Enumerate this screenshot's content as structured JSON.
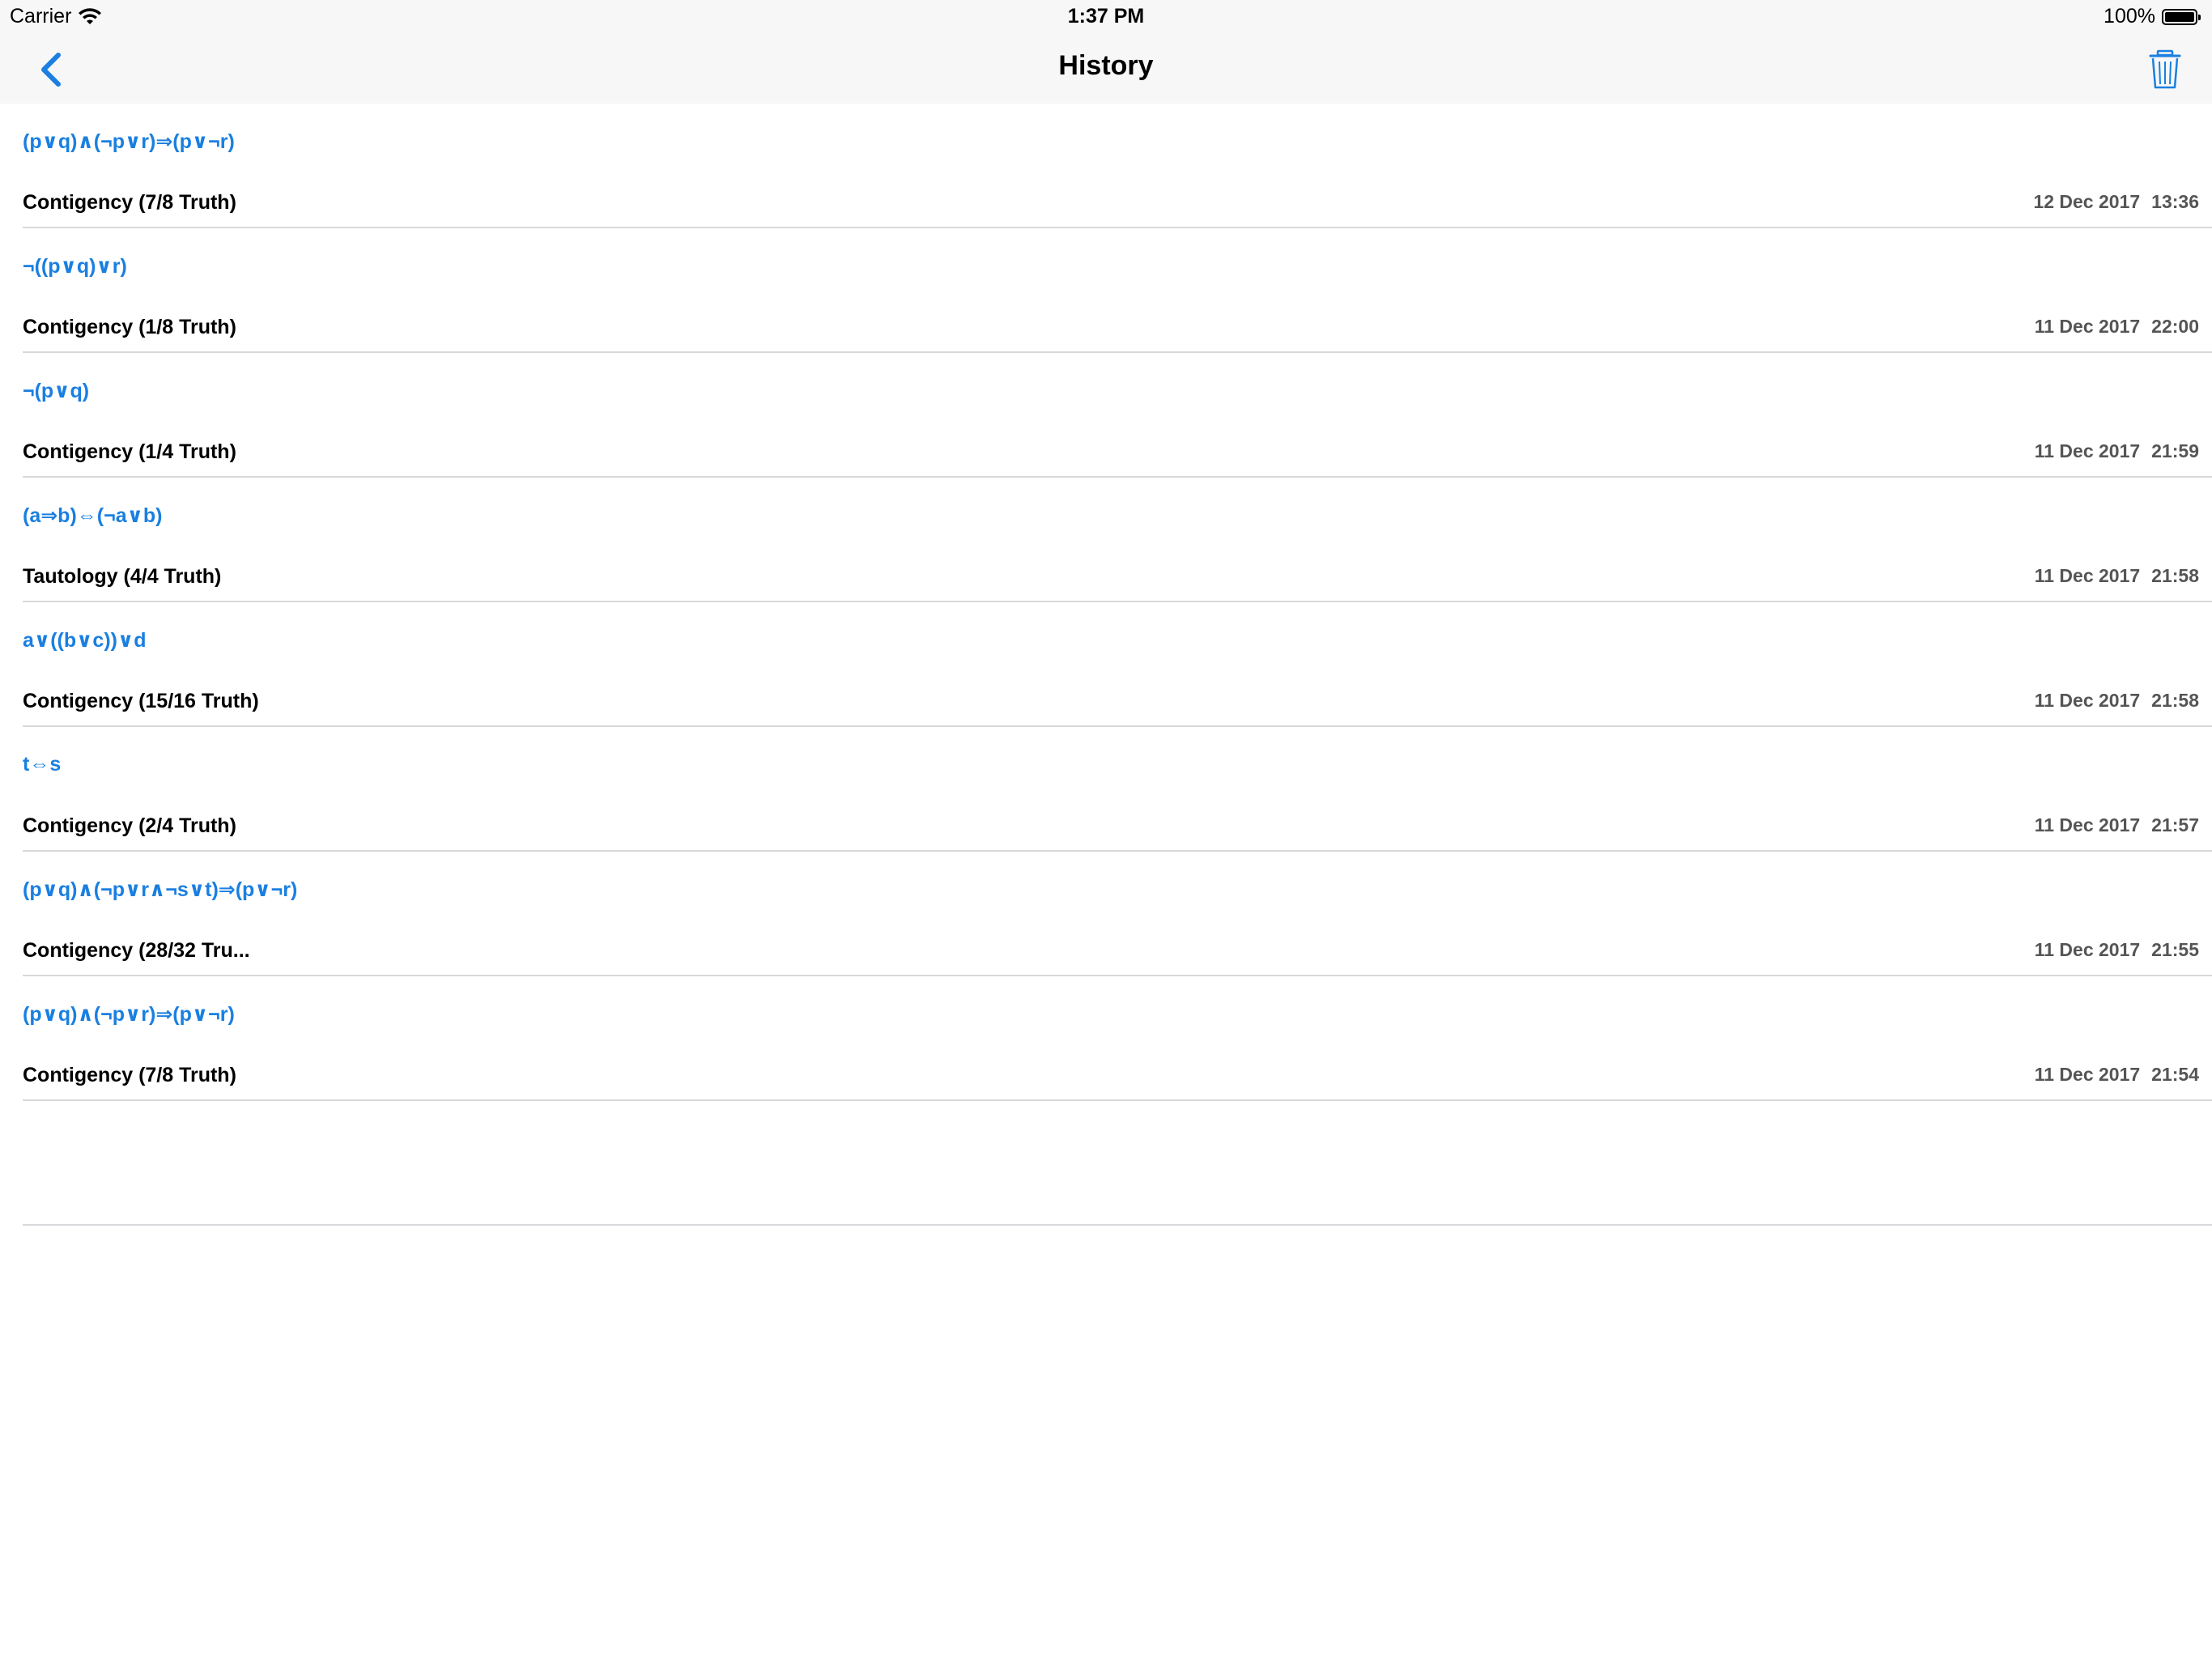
{
  "status_bar": {
    "carrier": "Carrier",
    "time": "1:37 PM",
    "battery_percent": "100%",
    "battery_level": 1.0
  },
  "nav": {
    "title": "History",
    "back_icon": "chevron-left-icon",
    "trash_icon": "trash-icon",
    "accent_color": "#1a7fe0"
  },
  "history": [
    {
      "expression": "(p∨q)∧(¬p∨r)⇒(p∨¬r)",
      "result": "Contigency (7/8 Truth)",
      "date": "12 Dec 2017",
      "time": "13:36"
    },
    {
      "expression": "¬((p∨q)∨r)",
      "result": "Contigency (1/8 Truth)",
      "date": "11 Dec 2017",
      "time": "22:00"
    },
    {
      "expression": "¬(p∨q)",
      "result": "Contigency (1/4 Truth)",
      "date": "11 Dec 2017",
      "time": "21:59"
    },
    {
      "expression": "(a⇒b)⇔(¬a∨b)",
      "result": "Tautology (4/4 Truth)",
      "date": "11 Dec 2017",
      "time": "21:58"
    },
    {
      "expression": "a∨((b∨c))∨d",
      "result": "Contigency (15/16 Truth)",
      "date": "11 Dec 2017",
      "time": "21:58"
    },
    {
      "expression": "t⇔s",
      "result": "Contigency (2/4 Truth)",
      "date": "11 Dec 2017",
      "time": "21:57"
    },
    {
      "expression": "(p∨q)∧(¬p∨r∧¬s∨t)⇒(p∨¬r)",
      "result": "Contigency (28/32 Tru...",
      "date": "11 Dec 2017",
      "time": "21:55"
    },
    {
      "expression": "(p∨q)∧(¬p∨r)⇒(p∨¬r)",
      "result": "Contigency (7/8 Truth)",
      "date": "11 Dec 2017",
      "time": "21:54"
    }
  ]
}
